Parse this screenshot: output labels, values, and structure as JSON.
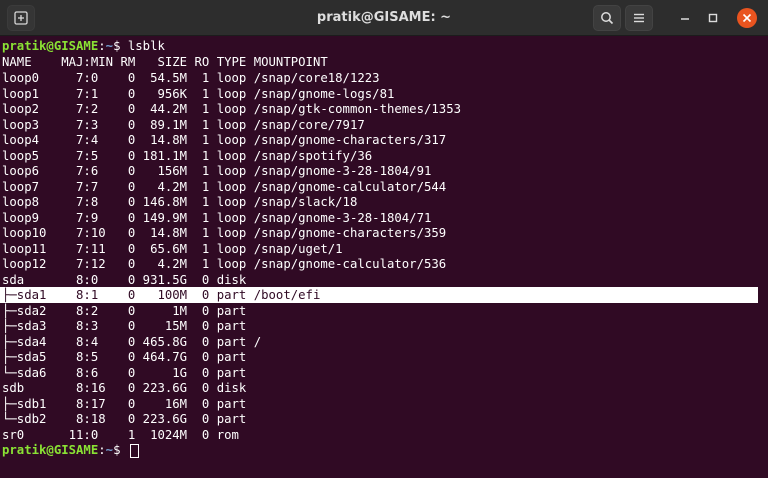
{
  "window": {
    "title": "pratik@GISAME: ~"
  },
  "icons": {
    "new_tab": "new-tab-icon",
    "search": "search-icon",
    "menu": "hamburger-menu-icon",
    "minimize": "minimize-icon",
    "maximize": "maximize-icon",
    "close": "close-icon"
  },
  "colors": {
    "terminal_bg": "#300a24",
    "prompt_user": "#8ae234",
    "prompt_path": "#729fcf",
    "close_button": "#e9541f"
  },
  "terminal": {
    "prompt_user": "pratik@GISAME",
    "prompt_sep": ":",
    "prompt_path": "~",
    "prompt_symbol": "$ ",
    "command": "lsblk",
    "header": "NAME    MAJ:MIN RM   SIZE RO TYPE MOUNTPOINT",
    "rows": [
      "loop0     7:0    0  54.5M  1 loop /snap/core18/1223",
      "loop1     7:1    0   956K  1 loop /snap/gnome-logs/81",
      "loop2     7:2    0  44.2M  1 loop /snap/gtk-common-themes/1353",
      "loop3     7:3    0  89.1M  1 loop /snap/core/7917",
      "loop4     7:4    0  14.8M  1 loop /snap/gnome-characters/317",
      "loop5     7:5    0 181.1M  1 loop /snap/spotify/36",
      "loop6     7:6    0   156M  1 loop /snap/gnome-3-28-1804/91",
      "loop7     7:7    0   4.2M  1 loop /snap/gnome-calculator/544",
      "loop8     7:8    0 146.8M  1 loop /snap/slack/18",
      "loop9     7:9    0 149.9M  1 loop /snap/gnome-3-28-1804/71",
      "loop10    7:10   0  14.8M  1 loop /snap/gnome-characters/359",
      "loop11    7:11   0  65.6M  1 loop /snap/uget/1",
      "loop12    7:12   0   4.2M  1 loop /snap/gnome-calculator/536",
      "sda       8:0    0 931.5G  0 disk ",
      "├─sda1    8:1    0   100M  0 part /boot/efi",
      "├─sda2    8:2    0     1M  0 part ",
      "├─sda3    8:3    0    15M  0 part ",
      "├─sda4    8:4    0 465.8G  0 part /",
      "├─sda5    8:5    0 464.7G  0 part ",
      "└─sda6    8:6    0     1G  0 part ",
      "sdb       8:16   0 223.6G  0 disk ",
      "├─sdb1    8:17   0    16M  0 part ",
      "└─sdb2    8:18   0 223.6G  0 part ",
      "sr0      11:0    1  1024M  0 rom  "
    ]
  }
}
